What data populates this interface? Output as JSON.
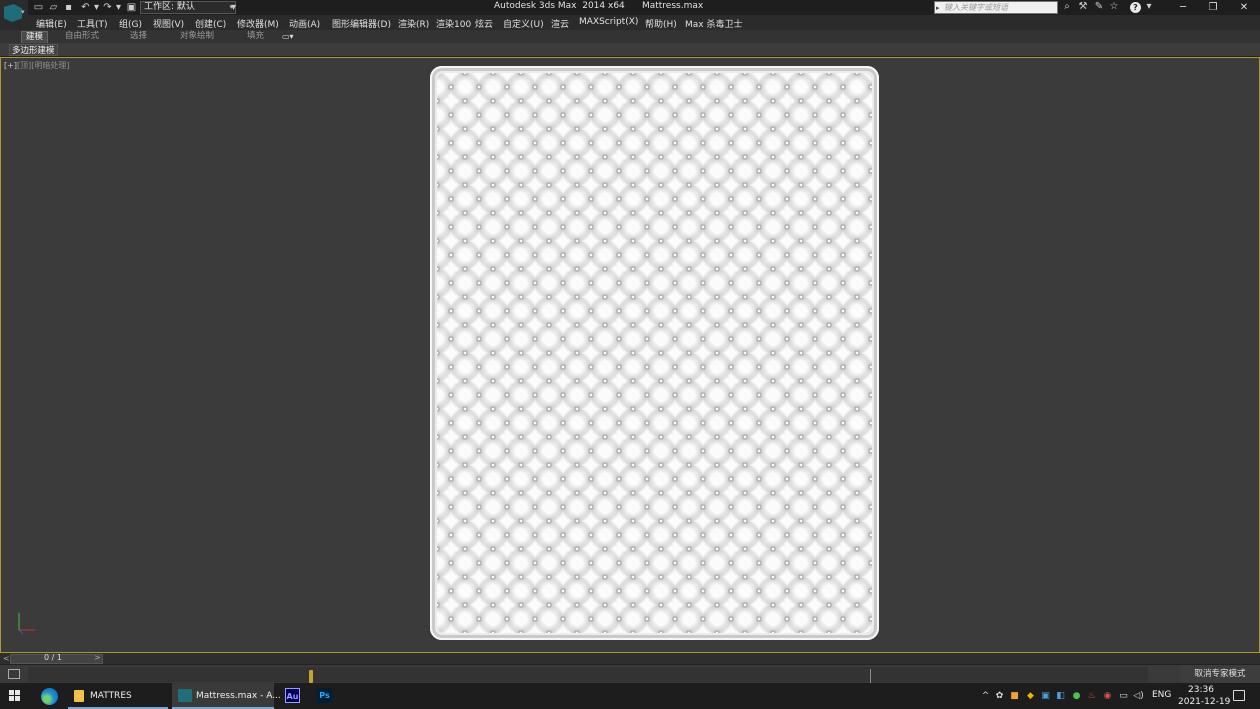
{
  "titlebar": {
    "workspace_label": "工作区: 默认",
    "app_title": "Autodesk 3ds Max  2014 x64",
    "file_title": "Mattress.max",
    "search_placeholder": "键入关键字或短语"
  },
  "menu": {
    "items": [
      "编辑(E)",
      "工具(T)",
      "组(G)",
      "视图(V)",
      "创建(C)",
      "修改器(M)",
      "动画(A)",
      "图形编辑器(D)",
      "渲染(R)",
      "渲染100",
      "炫云",
      "自定义(U)",
      "渲云",
      "MAXScript(X)",
      "帮助(H)",
      "Max 杀毒卫士"
    ]
  },
  "ribbon": {
    "tabs": [
      "建模",
      "自由形式",
      "选择",
      "对象绘制",
      "填充"
    ],
    "active_tab": "建模",
    "panel_label": "多边形建模"
  },
  "viewport": {
    "label_main": "[+]",
    "label_view": "[顶]",
    "label_shading": "[明暗处理]",
    "model": "mattress"
  },
  "timeslider": {
    "value": "0 / 1",
    "left_arrow": "<",
    "right_arrow": ">"
  },
  "statusbar": {
    "expert_mode_label": "取消专家模式"
  },
  "taskbar": {
    "folder_label": "MATTRES",
    "max_label": "Mattress.max - A...",
    "au_label": "Au",
    "ps_label": "Ps",
    "lang": "ENG",
    "time": "23:36",
    "date": "2021-12-19"
  },
  "colors": {
    "viewport_border": "#b3972f",
    "time_marker": "#c7a332",
    "max_brand": "#1f6e79"
  }
}
